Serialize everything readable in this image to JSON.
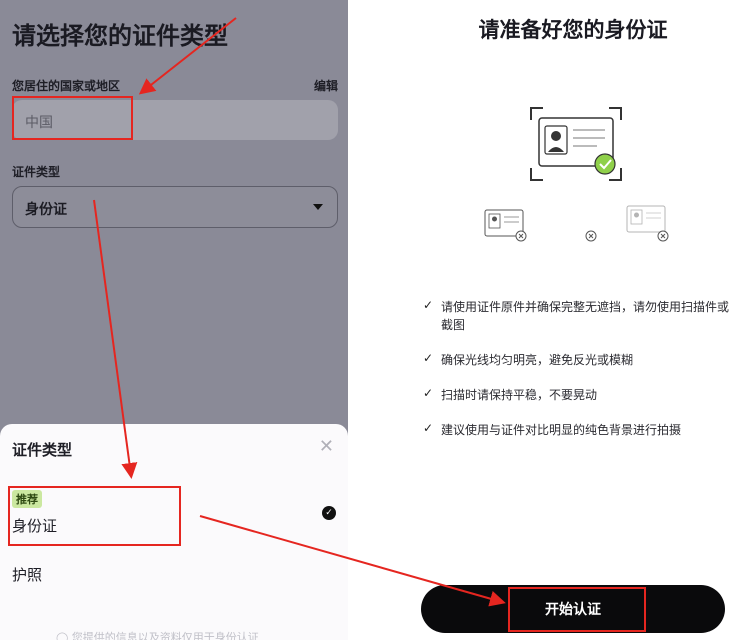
{
  "left": {
    "title": "请选择您的证件类型",
    "country_label": "您居住的国家或地区",
    "edit_label": "编辑",
    "country_value": "中国",
    "doc_type_label": "证件类型",
    "doc_type_value": "身份证",
    "sheet": {
      "title": "证件类型",
      "close_icon": "✕",
      "recommended_badge": "推荐",
      "option_id": "身份证",
      "option_passport": "护照",
      "footnote": "◯ 您提供的信息以及资料仅用于身份认证"
    }
  },
  "right": {
    "title": "请准备好您的身份证",
    "checklist": [
      "请使用证件原件并确保完整无遮挡，请勿使用扫描件或截图",
      "确保光线均匀明亮，避免反光或模糊",
      "扫描时请保持平稳，不要晃动",
      "建议使用与证件对比明显的纯色背景进行拍摄"
    ],
    "start_button": "开始认证"
  },
  "colors": {
    "annotation_red": "#e52620",
    "accent_green": "#8fd04a",
    "badge_green": "#cbe8a0"
  }
}
